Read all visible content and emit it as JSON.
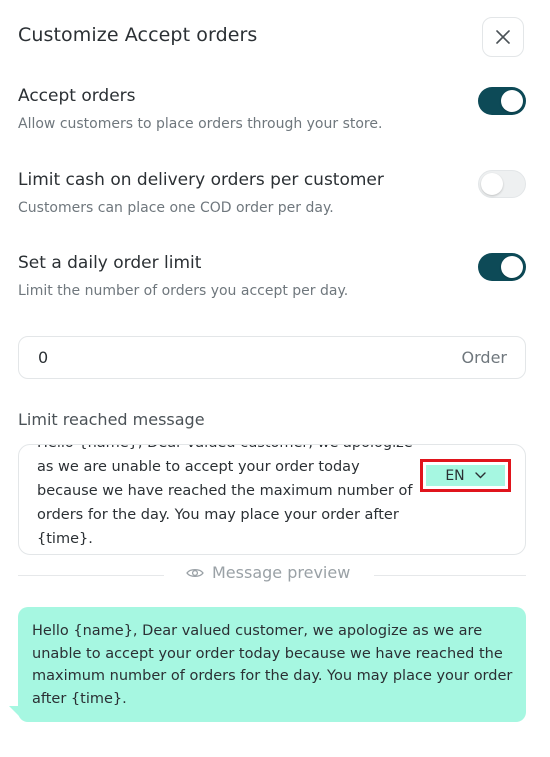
{
  "panel": {
    "title": "Customize Accept orders",
    "close_icon": "close-icon"
  },
  "settings": [
    {
      "label": "Accept orders",
      "description": "Allow customers to place orders through your store.",
      "enabled": true
    },
    {
      "label": "Limit cash on delivery orders per customer",
      "description": "Customers can place one COD order per day.",
      "enabled": false
    },
    {
      "label": "Set a daily order limit",
      "description": "Limit the number of orders you accept per day.",
      "enabled": true
    }
  ],
  "order_limit": {
    "value": "0",
    "unit": "Order"
  },
  "limit_message": {
    "label": "Limit reached message",
    "text": "Hello {name}, Dear valued customer, we apologize as we are unable to accept your order today because we have reached the maximum number of orders for the day. You may place your order after {time}.",
    "language": "EN"
  },
  "preview": {
    "label": "Message preview",
    "icon": "eye-icon",
    "text": "Hello {name}, Dear valued customer, we apologize as we are unable to accept your order today because we have reached the maximum number of orders for the day. You may place your order after {time}."
  },
  "colors": {
    "toggle_on": "#0d4a57",
    "bubble": "#a6f7e1",
    "highlight_border": "#e0141c"
  }
}
